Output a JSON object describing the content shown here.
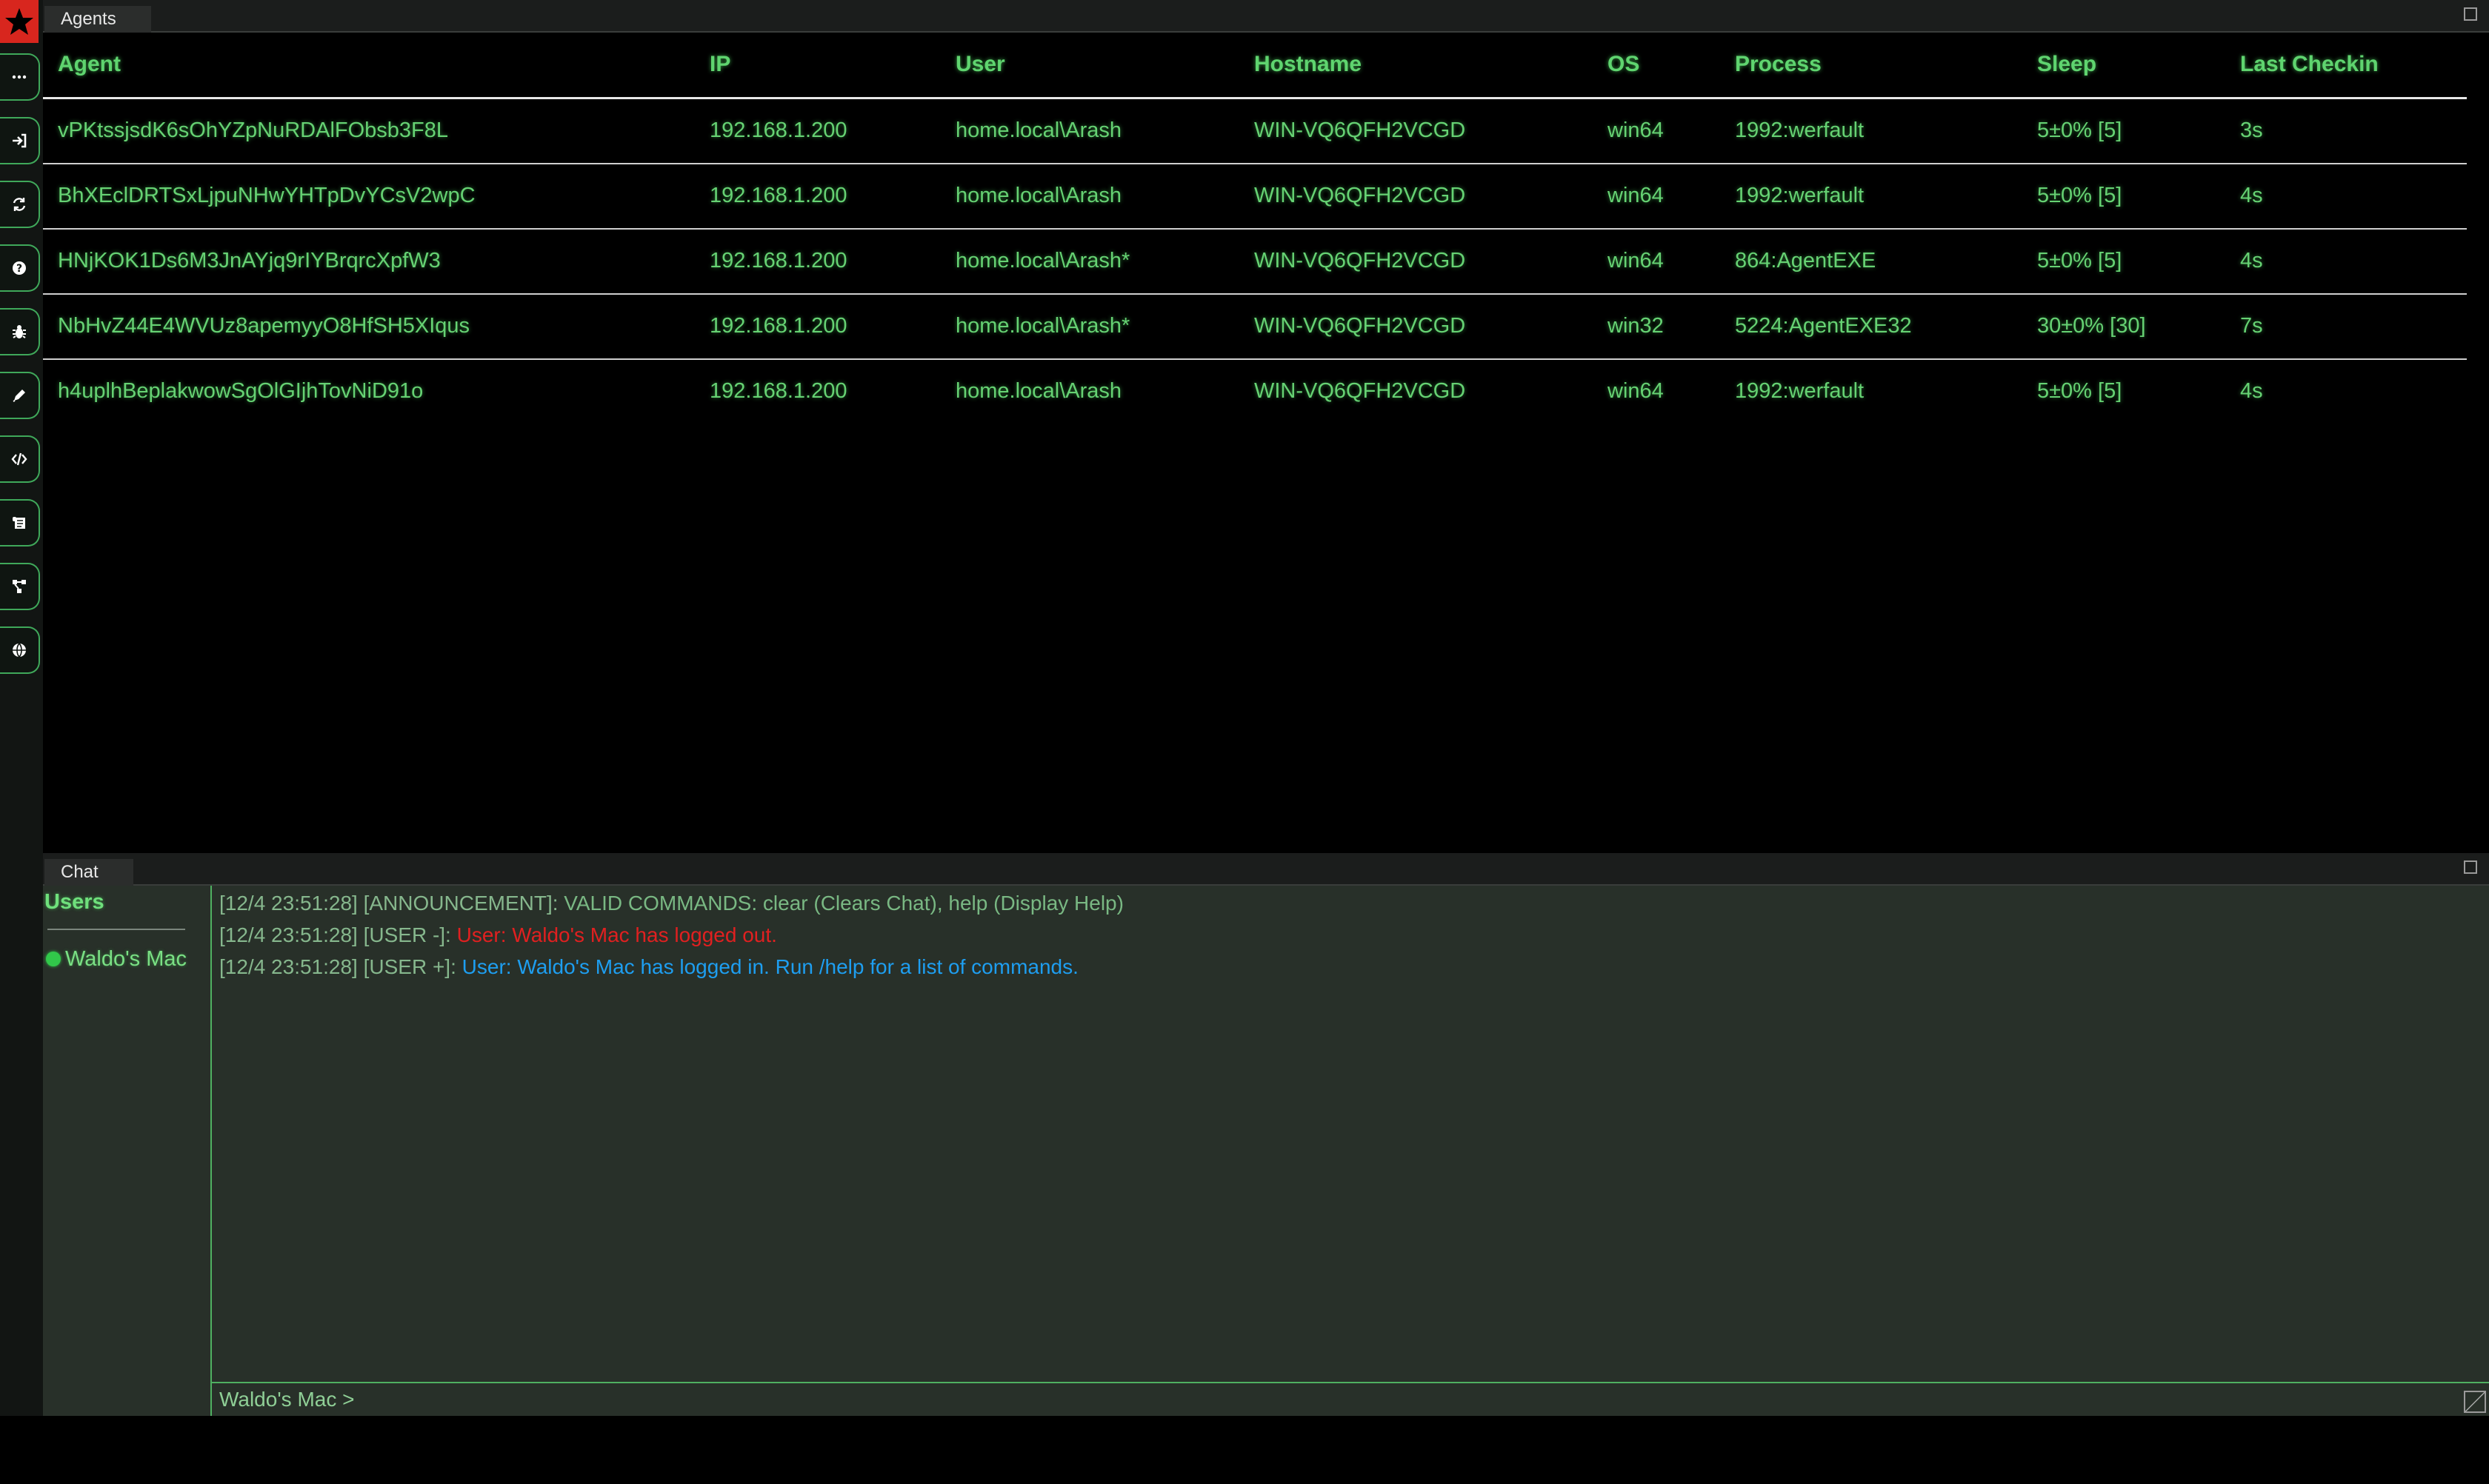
{
  "app": {
    "agents_tab": "Agents",
    "chat_tab": "Chat"
  },
  "sidebar": {
    "items": [
      {
        "name": "more"
      },
      {
        "name": "login"
      },
      {
        "name": "refresh"
      },
      {
        "name": "help"
      },
      {
        "name": "bug"
      },
      {
        "name": "edit"
      },
      {
        "name": "code"
      },
      {
        "name": "script"
      },
      {
        "name": "graph"
      },
      {
        "name": "globe"
      }
    ]
  },
  "agents": {
    "columns": {
      "agent": "Agent",
      "ip": "IP",
      "user": "User",
      "hostname": "Hostname",
      "os": "OS",
      "process": "Process",
      "sleep": "Sleep",
      "last_checkin": "Last Checkin"
    },
    "rows": [
      {
        "agent": "vPKtssjsdK6sOhYZpNuRDAlFObsb3F8L",
        "ip": "192.168.1.200",
        "user": "home.local\\Arash",
        "hostname": "WIN-VQ6QFH2VCGD",
        "os": "win64",
        "process": "1992:werfault",
        "sleep": "5±0% [5]",
        "last_checkin": "3s"
      },
      {
        "agent": "BhXEclDRTSxLjpuNHwYHTpDvYCsV2wpC",
        "ip": "192.168.1.200",
        "user": "home.local\\Arash",
        "hostname": "WIN-VQ6QFH2VCGD",
        "os": "win64",
        "process": "1992:werfault",
        "sleep": "5±0% [5]",
        "last_checkin": "4s"
      },
      {
        "agent": "HNjKOK1Ds6M3JnAYjq9rIYBrqrcXpfW3",
        "ip": "192.168.1.200",
        "user": "home.local\\Arash*",
        "hostname": "WIN-VQ6QFH2VCGD",
        "os": "win64",
        "process": "864:AgentEXE",
        "sleep": "5±0% [5]",
        "last_checkin": "4s"
      },
      {
        "agent": "NbHvZ44E4WVUz8apemyyO8HfSH5XIqus",
        "ip": "192.168.1.200",
        "user": "home.local\\Arash*",
        "hostname": "WIN-VQ6QFH2VCGD",
        "os": "win32",
        "process": "5224:AgentEXE32",
        "sleep": "30±0% [30]",
        "last_checkin": "7s"
      },
      {
        "agent": "h4uplhBeplakwowSgOlGIjhTovNiD91o",
        "ip": "192.168.1.200",
        "user": "home.local\\Arash",
        "hostname": "WIN-VQ6QFH2VCGD",
        "os": "win64",
        "process": "1992:werfault",
        "sleep": "5±0% [5]",
        "last_checkin": "4s"
      }
    ]
  },
  "chat": {
    "users_title": "Users",
    "users": [
      {
        "name": "Waldo's Mac",
        "status": "online"
      }
    ],
    "messages": [
      {
        "prefix": "[12/4 23:51:28] [ANNOUNCEMENT]: ",
        "text": "VALID COMMANDS: clear (Clears Chat), help (Display Help)",
        "color": "green"
      },
      {
        "prefix": "[12/4 23:51:28] [USER -]: ",
        "text": "User: Waldo's Mac has logged out.",
        "color": "red"
      },
      {
        "prefix": "[12/4 23:51:28] [USER +]: ",
        "text": "User: Waldo's Mac has logged in.  Run /help for a list of commands.",
        "color": "blue"
      }
    ],
    "prompt": "Waldo's Mac >",
    "input_value": ""
  },
  "colors": {
    "accent_green": "#5fd46f",
    "logo_red": "#d8261e",
    "chat_bg": "#283029",
    "error_red": "#e02020",
    "info_blue": "#1e9ef0"
  }
}
